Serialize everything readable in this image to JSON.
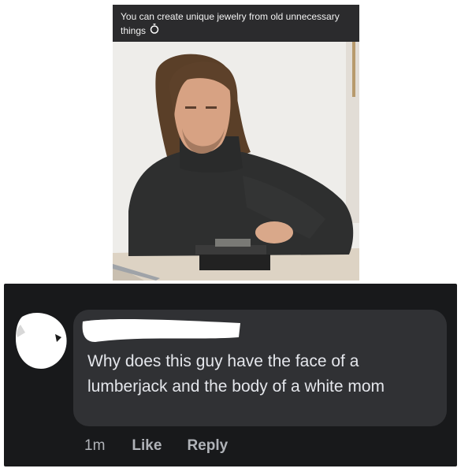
{
  "post": {
    "caption": "You can create unique jewelry from old unnecessary things",
    "caption_icon": "ring-icon"
  },
  "comment": {
    "text": "Why does this guy have the face of a lumberjack and the body of a white mom",
    "timestamp": "1m",
    "like_label": "Like",
    "reply_label": "Reply"
  },
  "colors": {
    "panel_bg": "#18191b",
    "bubble_bg": "#303134",
    "text": "#e4e6eb",
    "muted": "#b0b3b8",
    "caption_bg": "#2b2b2d"
  }
}
